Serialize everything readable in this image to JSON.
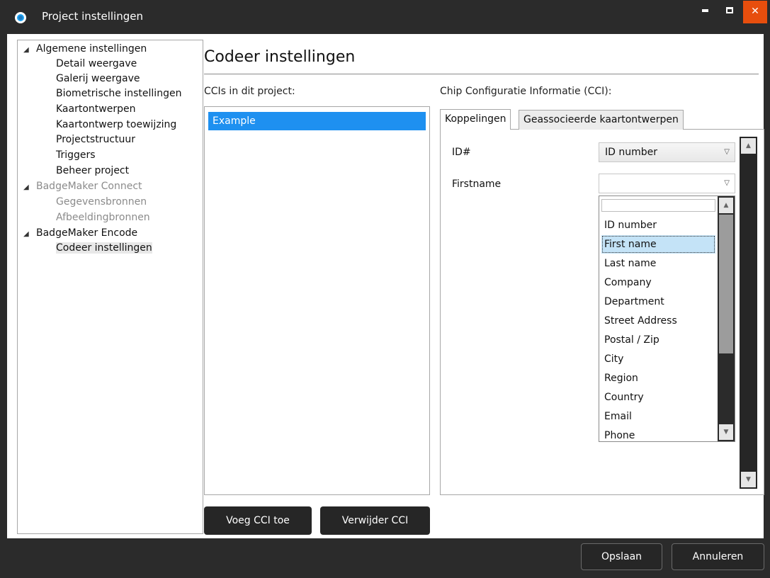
{
  "window": {
    "title": "Project instellingen",
    "close_label": "✕"
  },
  "tree": {
    "items": [
      {
        "label": "Algemene instellingen",
        "level": 0,
        "expanded": true
      },
      {
        "label": "Detail weergave",
        "level": 1
      },
      {
        "label": "Galerij weergave",
        "level": 1
      },
      {
        "label": "Biometrische instellingen",
        "level": 1
      },
      {
        "label": "Kaartontwerpen",
        "level": 1
      },
      {
        "label": "Kaartontwerp toewijzing",
        "level": 1
      },
      {
        "label": "Projectstructuur",
        "level": 1
      },
      {
        "label": "Triggers",
        "level": 1
      },
      {
        "label": "Beheer project",
        "level": 1
      },
      {
        "label": "BadgeMaker Connect",
        "level": 0,
        "expanded": true,
        "disabled": true
      },
      {
        "label": "Gegevensbronnen",
        "level": 1,
        "disabled": true
      },
      {
        "label": "Afbeeldingbronnen",
        "level": 1,
        "disabled": true
      },
      {
        "label": "BadgeMaker Encode",
        "level": 0,
        "expanded": true
      },
      {
        "label": "Codeer instellingen",
        "level": 1,
        "selected": true
      }
    ]
  },
  "main": {
    "title": "Codeer instellingen",
    "cci_list_label": "CCIs in dit project:",
    "cci_items": [
      "Example"
    ],
    "add_button": "Voeg CCI toe",
    "remove_button": "Verwijder CCI",
    "cci_info_label": "Chip Configuratie Informatie (CCI):",
    "tabs": [
      {
        "label": "Koppelingen",
        "active": true
      },
      {
        "label": "Geassocieerde kaartontwerpen",
        "active": false
      }
    ],
    "mappings": [
      {
        "label": "ID#",
        "value": "ID number"
      },
      {
        "label": "Firstname",
        "value": ""
      }
    ],
    "dropdown": {
      "search_value": "",
      "options": [
        "ID number",
        "First name",
        "Last name",
        "Company",
        "Department",
        "Street Address",
        "Postal / Zip",
        "City",
        "Region",
        "Country",
        "Email",
        "Phone"
      ],
      "highlighted": "First name"
    }
  },
  "footer": {
    "save_button": "Opslaan",
    "cancel_button": "Annuleren"
  },
  "colors": {
    "chrome": "#2b2b2b",
    "selection": "#1e90f0",
    "close": "#e74e0d",
    "highlight": "#c4e3f7"
  }
}
